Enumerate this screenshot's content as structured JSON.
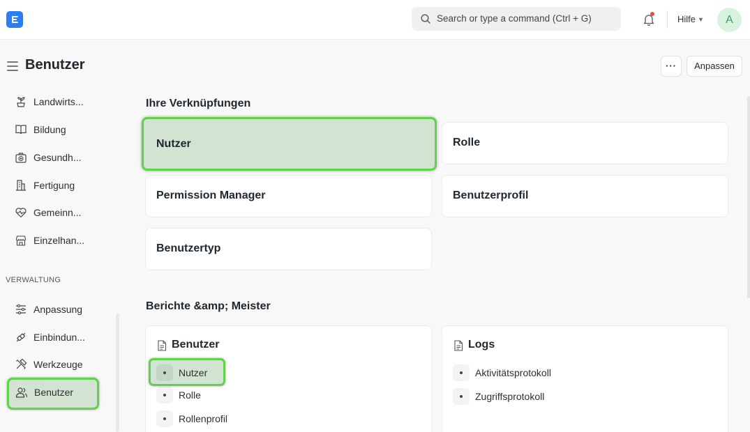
{
  "colors": {
    "brand": "#2b7cf6",
    "highlight_fill": "#d2e3d2",
    "highlight_border": "#5fd44a",
    "notification_dot": "#e24c4c",
    "avatar_bg": "#d9f2df",
    "avatar_fg": "#3f9f5e"
  },
  "navbar": {
    "logo_icon": "app-logo-icon",
    "search_placeholder": "Search or type a command (Ctrl + G)",
    "help_label": "Hilfe",
    "avatar_initial": "A"
  },
  "page": {
    "title": "Benutzer",
    "more_button": "···",
    "customize_button": "Anpassen"
  },
  "sidebar": {
    "items": [
      {
        "label": "Landwirts...",
        "icon": "plant-icon"
      },
      {
        "label": "Bildung",
        "icon": "book-icon"
      },
      {
        "label": "Gesundh...",
        "icon": "medical-kit-icon"
      },
      {
        "label": "Fertigung",
        "icon": "factory-icon"
      },
      {
        "label": "Gemeinn...",
        "icon": "heart-pulse-icon"
      },
      {
        "label": "Einzelhan...",
        "icon": "store-icon"
      }
    ],
    "section_label": "VERWALTUNG",
    "admin_items": [
      {
        "label": "Anpassung",
        "icon": "sliders-icon"
      },
      {
        "label": "Einbindun...",
        "icon": "integration-icon"
      },
      {
        "label": "Werkzeuge",
        "icon": "tools-icon"
      },
      {
        "label": "Benutzer",
        "icon": "users-icon",
        "active": true
      }
    ]
  },
  "shortcuts": {
    "title": "Ihre Verknüpfungen",
    "items": [
      {
        "label": "Nutzer",
        "active": true
      },
      {
        "label": "Rolle"
      },
      {
        "label": "Permission Manager"
      },
      {
        "label": "Benutzerprofil"
      },
      {
        "label": "Benutzertyp"
      }
    ]
  },
  "reports": {
    "title": "Berichte &amp; Meister",
    "cards": [
      {
        "title": "Benutzer",
        "icon": "document-icon",
        "links": [
          "Nutzer",
          "Rolle",
          "Rollenprofil"
        ]
      },
      {
        "title": "Logs",
        "icon": "document-icon",
        "links": [
          "Aktivitätsprotokoll",
          "Zugriffsprotokoll"
        ]
      }
    ]
  }
}
